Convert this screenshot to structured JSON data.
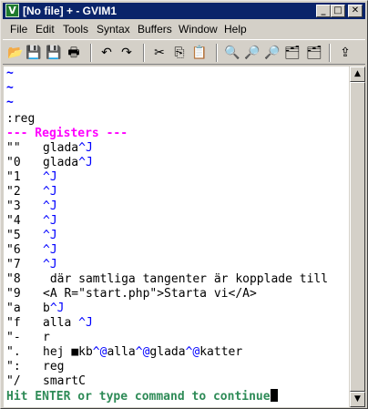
{
  "window": {
    "title": "[No file] + - GVIM1",
    "controls": {
      "minimize": "_",
      "maximize": "□",
      "close": "✕"
    }
  },
  "menu": [
    "File",
    "Edit",
    "Tools",
    "Syntax",
    "Buffers",
    "Window",
    "Help"
  ],
  "toolbar": {
    "icons": [
      "open-icon",
      "save-icon",
      "save-all-icon",
      "print-icon",
      "undo-icon",
      "redo-icon",
      "cut-icon",
      "copy-icon",
      "paste-icon",
      "find-replace-icon",
      "find-next-icon",
      "find-previous-icon",
      "load-session-icon",
      "save-session-icon",
      "run-script-icon"
    ]
  },
  "editor": {
    "tilde_lines": [
      "~",
      "~",
      "~"
    ],
    "command": ":reg",
    "header": "--- Registers ---",
    "registers": [
      {
        "name": "\"\"",
        "segments": [
          {
            "t": "glada",
            "c": "n"
          },
          {
            "t": "^J",
            "c": "s"
          }
        ]
      },
      {
        "name": "\"0",
        "segments": [
          {
            "t": "glada",
            "c": "n"
          },
          {
            "t": "^J",
            "c": "s"
          }
        ]
      },
      {
        "name": "\"1",
        "segments": [
          {
            "t": "^J",
            "c": "s"
          }
        ]
      },
      {
        "name": "\"2",
        "segments": [
          {
            "t": "^J",
            "c": "s"
          }
        ]
      },
      {
        "name": "\"3",
        "segments": [
          {
            "t": "^J",
            "c": "s"
          }
        ]
      },
      {
        "name": "\"4",
        "segments": [
          {
            "t": "^J",
            "c": "s"
          }
        ]
      },
      {
        "name": "\"5",
        "segments": [
          {
            "t": "^J",
            "c": "s"
          }
        ]
      },
      {
        "name": "\"6",
        "segments": [
          {
            "t": "^J",
            "c": "s"
          }
        ]
      },
      {
        "name": "\"7",
        "segments": [
          {
            "t": "^J",
            "c": "s"
          }
        ]
      },
      {
        "name": "\"8",
        "segments": [
          {
            "t": " där samtliga tangenter är kopplade till",
            "c": "n"
          }
        ]
      },
      {
        "name": "\"9",
        "segments": [
          {
            "t": "<A R=\"start.php\">Starta vi</A>",
            "c": "n"
          }
        ]
      },
      {
        "name": "\"a",
        "segments": [
          {
            "t": "b",
            "c": "n"
          },
          {
            "t": "^J",
            "c": "s"
          }
        ]
      },
      {
        "name": "\"f",
        "segments": [
          {
            "t": "alla ",
            "c": "n"
          },
          {
            "t": "^J",
            "c": "s"
          }
        ]
      },
      {
        "name": "\"-",
        "segments": [
          {
            "t": "r",
            "c": "n"
          }
        ]
      },
      {
        "name": "\".",
        "segments": [
          {
            "t": "hej ",
            "c": "n"
          },
          {
            "t": "■",
            "c": "n"
          },
          {
            "t": "kb",
            "c": "n"
          },
          {
            "t": "^@",
            "c": "s"
          },
          {
            "t": "alla",
            "c": "n"
          },
          {
            "t": "^@",
            "c": "s"
          },
          {
            "t": "glada",
            "c": "n"
          },
          {
            "t": "^@",
            "c": "s"
          },
          {
            "t": "katter",
            "c": "n"
          }
        ]
      },
      {
        "name": "\":",
        "segments": [
          {
            "t": "reg",
            "c": "n"
          }
        ]
      },
      {
        "name": "\"/",
        "segments": [
          {
            "t": "smartC",
            "c": "n"
          }
        ]
      }
    ],
    "more_prompt": "Hit ENTER or type command to continue"
  },
  "colors": {
    "title_bar": "#0a246a",
    "tilde": "#0000ff",
    "header": "#ff00ff",
    "special_key": "#0000ff",
    "more_prompt": "#2e8b57"
  }
}
